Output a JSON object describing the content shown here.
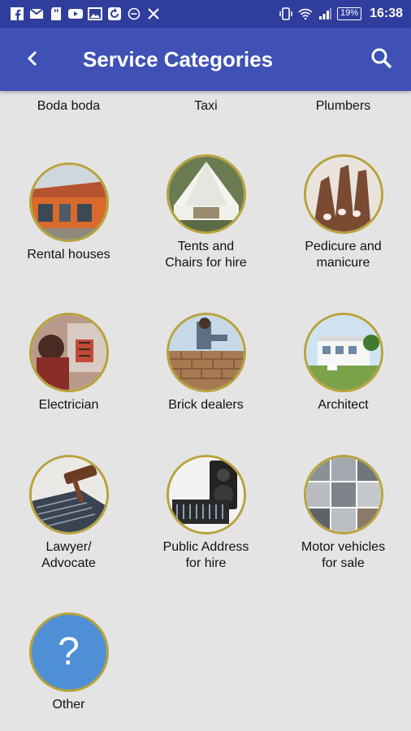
{
  "status_bar": {
    "icons": [
      "facebook-icon",
      "gmail-icon",
      "sd-card-icon",
      "youtube-icon",
      "image-icon",
      "sync-icon",
      "minus-circle-icon",
      "x-icon"
    ],
    "battery": "19%",
    "time": "16:38"
  },
  "app_bar": {
    "title": "Service Categories",
    "back_icon": "back-arrow-icon",
    "search_icon": "search-icon",
    "color": "#3f51b5"
  },
  "top_row": [
    "Boda boda",
    "Taxi",
    "Plumbers"
  ],
  "categories": [
    {
      "label": "Rental houses"
    },
    {
      "label": "Tents and\nChairs for hire"
    },
    {
      "label": "Pedicure and\nmanicure"
    },
    {
      "label": "Electrician"
    },
    {
      "label": "Brick dealers"
    },
    {
      "label": "Architect"
    },
    {
      "label": "Lawyer/\nAdvocate"
    },
    {
      "label": "Public Address\nfor hire"
    },
    {
      "label": "Motor vehicles\nfor sale"
    },
    {
      "label": "Other",
      "icon": "question-mark-icon",
      "icon_text": "?"
    }
  ],
  "colors": {
    "status_bar": "#2f3d9c",
    "background": "#e4e4e4",
    "circle_border": "#b7a33c",
    "other_circle": "#4f8fd6"
  }
}
